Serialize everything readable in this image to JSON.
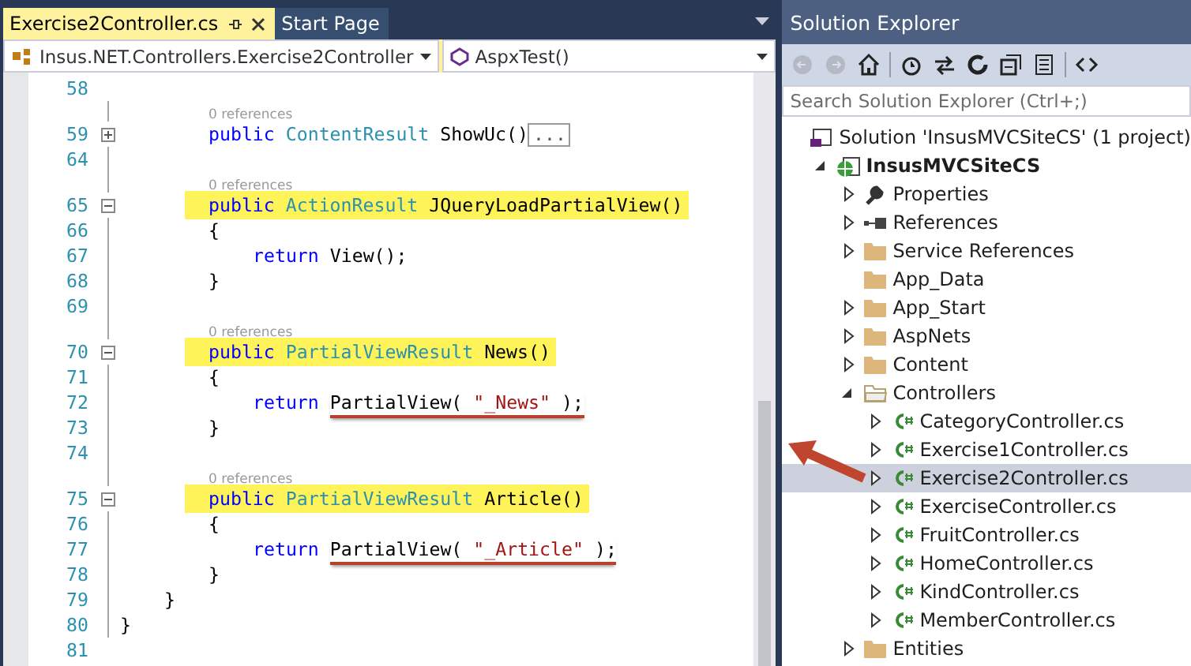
{
  "editor": {
    "tabs": [
      {
        "label": "Exercise2Controller.cs",
        "selected": true,
        "pinned": true,
        "closable": true
      },
      {
        "label": "Start Page",
        "selected": false,
        "pinned": false,
        "closable": false
      }
    ],
    "navigation": {
      "type_dropdown": "Insus.NET.Controllers.Exercise2Controller",
      "member_dropdown": "AspxTest()"
    },
    "lines": [
      {
        "kind": "top",
        "number": "58"
      },
      {
        "kind": "lens",
        "text": "0 references"
      },
      {
        "kind": "member",
        "number": "59",
        "expanded": false,
        "segments": [
          {
            "kind": "plain",
            "tokens": [
              {
                "kind": "keyword",
                "text": "public"
              },
              {
                "kind": "type",
                "text": "ContentResult"
              },
              {
                "kind": "plain",
                "text": "ShowUc()"
              }
            ]
          }
        ],
        "collapsed_text": "..."
      },
      {
        "kind": "top",
        "number": "64"
      },
      {
        "kind": "lens",
        "text": "0 references"
      },
      {
        "kind": "member",
        "number": "65",
        "expanded": true,
        "segments": [
          {
            "kind": "highlight",
            "tokens": [
              {
                "kind": "keyword",
                "text": "public"
              },
              {
                "kind": "type",
                "text": "ActionResult"
              },
              {
                "kind": "plain",
                "text": "JQueryLoadPartialView()"
              }
            ]
          }
        ]
      },
      {
        "kind": "member",
        "number": "66",
        "segments": [
          {
            "kind": "plain",
            "tokens": [
              {
                "kind": "plain",
                "text": "{"
              }
            ]
          }
        ]
      },
      {
        "kind": "body",
        "number": "67",
        "segments": [
          {
            "kind": "plain",
            "tokens": [
              {
                "kind": "keyword",
                "text": "return"
              },
              {
                "kind": "plain",
                "text": "View();"
              }
            ]
          }
        ]
      },
      {
        "kind": "member",
        "number": "68",
        "segments": [
          {
            "kind": "plain",
            "tokens": [
              {
                "kind": "plain",
                "text": "}"
              }
            ]
          }
        ]
      },
      {
        "kind": "top",
        "number": "69"
      },
      {
        "kind": "lens",
        "text": "0 references"
      },
      {
        "kind": "member",
        "number": "70",
        "expanded": true,
        "segments": [
          {
            "kind": "highlight",
            "tokens": [
              {
                "kind": "keyword",
                "text": "public"
              },
              {
                "kind": "type",
                "text": "PartialViewResult"
              },
              {
                "kind": "plain",
                "text": "News()"
              }
            ]
          }
        ]
      },
      {
        "kind": "member",
        "number": "71",
        "segments": [
          {
            "kind": "plain",
            "tokens": [
              {
                "kind": "plain",
                "text": "{"
              }
            ]
          }
        ]
      },
      {
        "kind": "body",
        "number": "72",
        "segments": [
          {
            "kind": "plain",
            "tokens": [
              {
                "kind": "keyword",
                "text": "return"
              }
            ]
          },
          {
            "kind": "underline",
            "tokens": [
              {
                "kind": "plain",
                "text": "PartialView("
              },
              {
                "kind": "string",
                "text": "\"_News\""
              },
              {
                "kind": "plain",
                "text": ");"
              }
            ]
          }
        ]
      },
      {
        "kind": "member",
        "number": "73",
        "segments": [
          {
            "kind": "plain",
            "tokens": [
              {
                "kind": "plain",
                "text": "}"
              }
            ]
          }
        ]
      },
      {
        "kind": "top",
        "number": "74"
      },
      {
        "kind": "lens",
        "text": "0 references"
      },
      {
        "kind": "member",
        "number": "75",
        "expanded": true,
        "segments": [
          {
            "kind": "highlight",
            "tokens": [
              {
                "kind": "keyword",
                "text": "public"
              },
              {
                "kind": "type",
                "text": "PartialViewResult"
              },
              {
                "kind": "plain",
                "text": "Article()"
              }
            ]
          }
        ]
      },
      {
        "kind": "member",
        "number": "76",
        "segments": [
          {
            "kind": "plain",
            "tokens": [
              {
                "kind": "plain",
                "text": "{"
              }
            ]
          }
        ]
      },
      {
        "kind": "body",
        "number": "77",
        "segments": [
          {
            "kind": "plain",
            "tokens": [
              {
                "kind": "keyword",
                "text": "return"
              }
            ]
          },
          {
            "kind": "underline",
            "tokens": [
              {
                "kind": "plain",
                "text": "PartialView("
              },
              {
                "kind": "string",
                "text": "\"_Article\""
              },
              {
                "kind": "plain",
                "text": ");"
              }
            ]
          }
        ]
      },
      {
        "kind": "member",
        "number": "78",
        "segments": [
          {
            "kind": "plain",
            "tokens": [
              {
                "kind": "plain",
                "text": "}"
              }
            ]
          }
        ]
      },
      {
        "kind": "class",
        "number": "79",
        "segments": [
          {
            "kind": "plain",
            "tokens": [
              {
                "kind": "plain",
                "text": "}"
              }
            ]
          }
        ]
      },
      {
        "kind": "top",
        "number": "80",
        "segments": [
          {
            "kind": "plain",
            "tokens": [
              {
                "kind": "plain",
                "text": "}"
              }
            ]
          }
        ]
      },
      {
        "kind": "top",
        "number": "81"
      }
    ]
  },
  "solution_explorer": {
    "title": "Solution Explorer",
    "search": {
      "placeholder": "Search Solution Explorer (Ctrl+;)"
    },
    "tree": [
      {
        "label": "Solution 'InsusMVCSiteCS' (1 project)",
        "kind": "solution",
        "selected": false,
        "children": [
          {
            "label": "InsusMVCSiteCS",
            "kind": "project",
            "expanded": true,
            "selected": false,
            "children": [
              {
                "label": "Properties",
                "kind": "properties",
                "expanded": false,
                "selected": false
              },
              {
                "label": "References",
                "kind": "references",
                "expanded": false,
                "selected": false
              },
              {
                "label": "Service References",
                "kind": "folder",
                "expanded": false,
                "selected": false
              },
              {
                "label": "App_Data",
                "kind": "folder",
                "selected": false
              },
              {
                "label": "App_Start",
                "kind": "folder",
                "expanded": false,
                "selected": false
              },
              {
                "label": "AspNets",
                "kind": "folder",
                "expanded": false,
                "selected": false
              },
              {
                "label": "Content",
                "kind": "folder",
                "expanded": false,
                "selected": false
              },
              {
                "label": "Controllers",
                "kind": "folder",
                "expanded": true,
                "selected": false,
                "children": [
                  {
                    "label": "CategoryController.cs",
                    "kind": "csharp",
                    "expanded": false,
                    "selected": false
                  },
                  {
                    "label": "Exercise1Controller.cs",
                    "kind": "csharp",
                    "expanded": false,
                    "selected": false
                  },
                  {
                    "label": "Exercise2Controller.cs",
                    "kind": "csharp",
                    "expanded": false,
                    "selected": true
                  },
                  {
                    "label": "ExerciseController.cs",
                    "kind": "csharp",
                    "expanded": false,
                    "selected": false
                  },
                  {
                    "label": "FruitController.cs",
                    "kind": "csharp",
                    "expanded": false,
                    "selected": false
                  },
                  {
                    "label": "HomeController.cs",
                    "kind": "csharp",
                    "expanded": false,
                    "selected": false
                  },
                  {
                    "label": "KindController.cs",
                    "kind": "csharp",
                    "expanded": false,
                    "selected": false
                  },
                  {
                    "label": "MemberController.cs",
                    "kind": "csharp",
                    "expanded": false,
                    "selected": false
                  }
                ]
              },
              {
                "label": "Entities",
                "kind": "folder",
                "expanded": false,
                "selected": false
              }
            ]
          }
        ]
      }
    ]
  }
}
